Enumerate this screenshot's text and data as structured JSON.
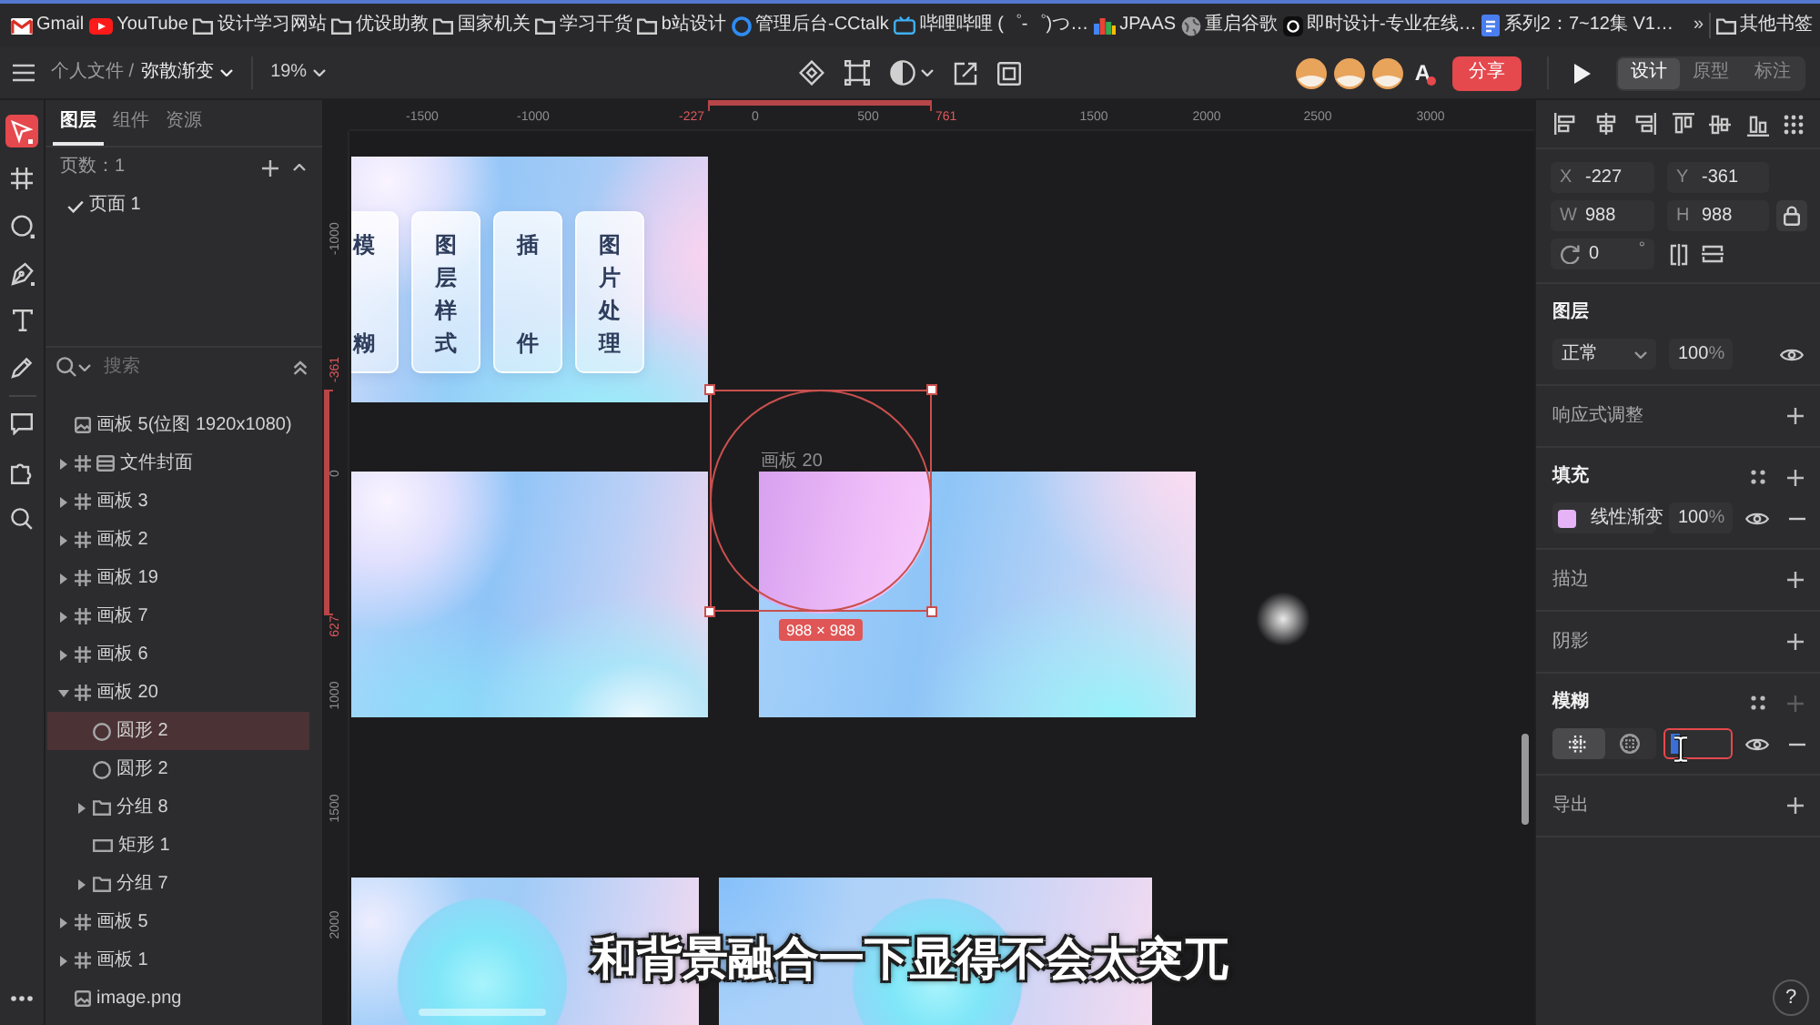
{
  "bookmarks_bar": {
    "items": [
      {
        "label": "Gmail",
        "kind": "gmail"
      },
      {
        "label": "YouTube",
        "kind": "youtube"
      },
      {
        "label": "设计学习网站",
        "kind": "folder"
      },
      {
        "label": "优设助教",
        "kind": "folder"
      },
      {
        "label": "国家机关",
        "kind": "folder"
      },
      {
        "label": "学习干货",
        "kind": "folder"
      },
      {
        "label": "b站设计",
        "kind": "folder"
      },
      {
        "label": "管理后台-CCtalk",
        "kind": "ring"
      },
      {
        "label": "哔哩哔哩 (゜-゜)つ…",
        "kind": "tv"
      },
      {
        "label": "JPAAS",
        "kind": "blocks"
      },
      {
        "label": "重启谷歌",
        "kind": "globe"
      },
      {
        "label": "即时设计-专业在线…",
        "kind": "logo"
      },
      {
        "label": "系列2：7~12集 V1…",
        "kind": "doc"
      }
    ],
    "overflow": "»",
    "other": {
      "label": "其他书签",
      "kind": "folder"
    }
  },
  "toolbar": {
    "breadcrumb_parent": "个人文件 /",
    "breadcrumb_current": "弥散渐变",
    "zoom": "19%",
    "collaborators": [
      {
        "kind": "avatar"
      },
      {
        "kind": "avatar"
      },
      {
        "kind": "avatar"
      }
    ],
    "font_button": "A",
    "share_button": "分享",
    "mode_tabs": [
      {
        "label": "设计",
        "selected": true
      },
      {
        "label": "原型",
        "selected": false
      },
      {
        "label": "标注",
        "selected": false
      }
    ]
  },
  "tool_rail": {
    "tools": [
      {
        "kind": "select",
        "selected": true
      },
      {
        "kind": "frame",
        "selected": false
      },
      {
        "kind": "ellipse",
        "selected": false
      },
      {
        "kind": "pen",
        "selected": false
      },
      {
        "kind": "text",
        "selected": false
      },
      {
        "kind": "pencil",
        "selected": false
      }
    ],
    "extras": [
      {
        "kind": "comment",
        "selected": false
      },
      {
        "kind": "plugin",
        "selected": false
      },
      {
        "kind": "search",
        "selected": false
      }
    ]
  },
  "layers_panel": {
    "tabs": [
      {
        "label": "图层",
        "selected": true
      },
      {
        "label": "组件",
        "selected": false
      },
      {
        "label": "资源",
        "selected": false
      }
    ],
    "pages_header": "页数：1",
    "pages": [
      {
        "label": "页面 1",
        "selected": true
      }
    ],
    "search_placeholder": "搜索",
    "layers": [
      {
        "label": "画板 5(位图 1920x1080)",
        "kind": "image",
        "selected": false
      },
      {
        "label": "文件封面",
        "kind": "cover",
        "expanded": false,
        "selected": false
      },
      {
        "label": "画板 3",
        "kind": "frame",
        "expanded": false,
        "selected": false
      },
      {
        "label": "画板 2",
        "kind": "frame",
        "expanded": false,
        "selected": false
      },
      {
        "label": "画板 19",
        "kind": "frame",
        "expanded": false,
        "selected": false
      },
      {
        "label": "画板 7",
        "kind": "frame",
        "expanded": false,
        "selected": false
      },
      {
        "label": "画板 6",
        "kind": "frame",
        "expanded": false,
        "selected": false
      },
      {
        "label": "画板 20",
        "kind": "frame",
        "expanded": true,
        "selected": false,
        "children": [
          {
            "label": "圆形 2",
            "kind": "ellipse",
            "selected": true
          },
          {
            "label": "圆形 2",
            "kind": "ellipse",
            "selected": false
          },
          {
            "label": "分组 8",
            "kind": "group",
            "expanded": false,
            "selected": false
          },
          {
            "label": "矩形 1",
            "kind": "rect",
            "selected": false
          },
          {
            "label": "分组 7",
            "kind": "group",
            "expanded": false,
            "selected": false
          }
        ]
      },
      {
        "label": "画板 5",
        "kind": "frame",
        "expanded": false,
        "selected": false
      },
      {
        "label": "画板 1",
        "kind": "frame",
        "expanded": false,
        "selected": false
      },
      {
        "label": "image.png",
        "kind": "image",
        "selected": false
      }
    ]
  },
  "canvas": {
    "top_ruler": [
      {
        "text": "-1500",
        "kind": "tick"
      },
      {
        "text": "-1000",
        "kind": "tick"
      },
      {
        "text": "-227",
        "kind": "selection"
      },
      {
        "text": "0",
        "kind": "tick"
      },
      {
        "text": "500",
        "kind": "tick"
      },
      {
        "text": "761",
        "kind": "selection"
      },
      {
        "text": "1500",
        "kind": "tick"
      },
      {
        "text": "2000",
        "kind": "tick"
      },
      {
        "text": "2500",
        "kind": "tick"
      },
      {
        "text": "3000",
        "kind": "tick"
      }
    ],
    "left_ruler": [
      {
        "text": "-1000",
        "kind": "tick"
      },
      {
        "text": "-361",
        "kind": "selection"
      },
      {
        "text": "0",
        "kind": "tick"
      },
      {
        "text": "627",
        "kind": "selection"
      },
      {
        "text": "1000",
        "kind": "tick"
      },
      {
        "text": "1500",
        "kind": "tick"
      },
      {
        "text": "2000",
        "kind": "tick"
      }
    ],
    "cards": [
      {
        "text": "模糊"
      },
      {
        "text": "图层样式"
      },
      {
        "text": "插件"
      },
      {
        "text": "图片处理"
      }
    ],
    "artboard_label": "画板 20",
    "selection_size": "988 × 988"
  },
  "inspector": {
    "geometry": [
      {
        "label": "X",
        "value": "-227"
      },
      {
        "label": "Y",
        "value": "-361"
      },
      {
        "label": "W",
        "value": "988"
      },
      {
        "label": "H",
        "value": "988"
      }
    ],
    "rotation": {
      "value": "0",
      "unit": "°"
    },
    "sections": [
      {
        "kind": "layer",
        "title": "图层",
        "blend_mode": "正常",
        "opacity": "100",
        "unit": "%",
        "visible": true
      },
      {
        "kind": "collapsed",
        "title": "响应式调整"
      },
      {
        "kind": "fill",
        "title": "填充",
        "fills": [
          {
            "color": "#e6b4f6",
            "type": "线性渐变",
            "opacity": "100",
            "unit": "%",
            "visible": true
          }
        ]
      },
      {
        "kind": "collapsed",
        "title": "描边"
      },
      {
        "kind": "collapsed",
        "title": "阴影"
      },
      {
        "kind": "blur",
        "title": "模糊",
        "add_disabled": true,
        "modes": [
          {
            "kind": "layer",
            "selected": true
          },
          {
            "kind": "background",
            "selected": false
          }
        ],
        "field_focused": true,
        "visible": true
      },
      {
        "kind": "collapsed",
        "title": "导出"
      }
    ],
    "help": "?"
  },
  "subtitle": "和背景融合一下显得不会太突兀"
}
